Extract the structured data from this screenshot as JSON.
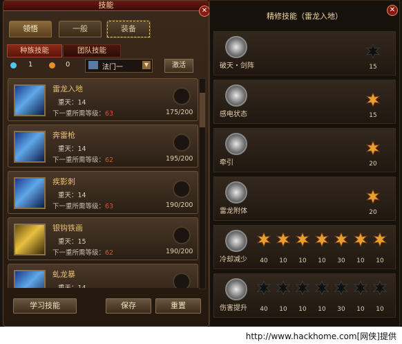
{
  "window": {
    "title": "技能",
    "close": "✕"
  },
  "tabs": [
    {
      "label": "领悟"
    },
    {
      "label": "一般"
    },
    {
      "label": "装备"
    }
  ],
  "subtabs": [
    {
      "label": "种族技能"
    },
    {
      "label": "团队技能"
    }
  ],
  "stats": {
    "points_a": "1",
    "points_b": "0",
    "school": "法门一",
    "activate_label": "激活"
  },
  "skills": [
    {
      "name": "雷龙入地",
      "level": "重天：14",
      "req_label": "下一重所需等级：",
      "req_level": "63",
      "exp": "175/200"
    },
    {
      "name": "奔雷枪",
      "level": "重天：14",
      "req_label": "下一重所需等级：",
      "req_level": "62",
      "exp": "195/200"
    },
    {
      "name": "疾影刺",
      "level": "重天：14",
      "req_label": "下一重所需等级：",
      "req_level": "63",
      "exp": "190/200"
    },
    {
      "name": "银钩铁画",
      "level": "重天：15",
      "req_label": "下一重所需等级：",
      "req_level": "62",
      "exp": "190/200"
    },
    {
      "name": "虬龙暴",
      "level": "重天：14",
      "req_label": "",
      "req_level": "",
      "exp": ""
    }
  ],
  "buttons": {
    "learn": "学习技能",
    "save": "保存",
    "reset": "重置"
  },
  "refine": {
    "title": "精修技能（雷龙入地）",
    "nodes": [
      {
        "label": "破天・剑阵",
        "values": [
          "15"
        ]
      },
      {
        "label": "感电状态",
        "values": [
          "15"
        ]
      },
      {
        "label": "牵引",
        "values": [
          "20"
        ]
      },
      {
        "label": "雷龙附体",
        "values": [
          "20"
        ]
      },
      {
        "label": "冷却减少",
        "values": [
          "40",
          "10",
          "10",
          "10",
          "30",
          "10",
          "10"
        ]
      },
      {
        "label": "伤害提升",
        "values": [
          "40",
          "10",
          "10",
          "10",
          "30",
          "10",
          "10"
        ]
      }
    ]
  },
  "footer": {
    "text": "http://www.hackhome.com[网侠]提供"
  },
  "colors": {
    "lit_star": "#e8a030",
    "dark_star": "#101010"
  }
}
